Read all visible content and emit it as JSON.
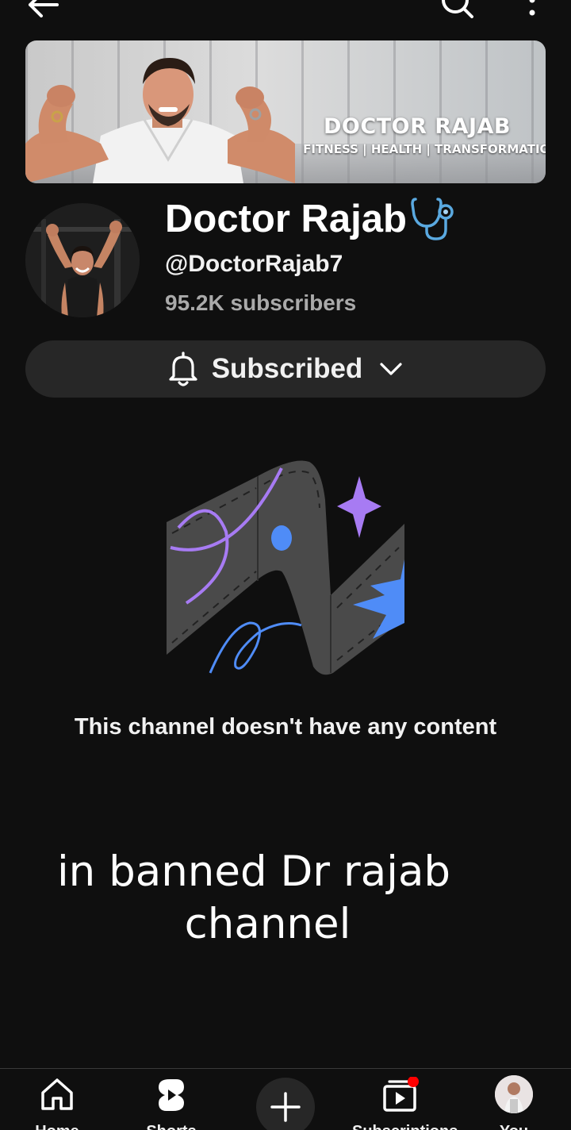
{
  "topbar": {
    "back_icon": "arrow-left-icon",
    "search_icon": "search-icon",
    "more_icon": "more-vertical-icon"
  },
  "banner": {
    "title": "DOCTOR RAJAB",
    "tagline": "FITNESS | HEALTH | TRANSFORMATION"
  },
  "channel": {
    "name": "Doctor Rajab",
    "name_icon": "stethoscope-icon",
    "handle": "@DoctorRajab7",
    "subscribers": "95.2K subscribers"
  },
  "subscribe_button": {
    "label": "Subscribed",
    "icon": "bell-icon"
  },
  "empty_state": {
    "message": "This channel doesn't have any content"
  },
  "caption": {
    "line1": "in banned Dr rajab",
    "line2": "channel"
  },
  "bottom_nav": {
    "items": [
      {
        "label": "Home",
        "icon": "home-icon"
      },
      {
        "label": "Shorts",
        "icon": "shorts-icon"
      },
      {
        "label": "",
        "icon": "plus-icon"
      },
      {
        "label": "Subscriptions",
        "icon": "subscriptions-icon",
        "badge": true
      },
      {
        "label": "You",
        "icon": "avatar"
      }
    ]
  },
  "colors": {
    "background": "#0f0f0f",
    "button": "#272727",
    "secondary_text": "#aaaaaa",
    "badge_red": "#ff0000",
    "accent_purple": "#a77bf3",
    "accent_blue": "#4f8cf7"
  }
}
